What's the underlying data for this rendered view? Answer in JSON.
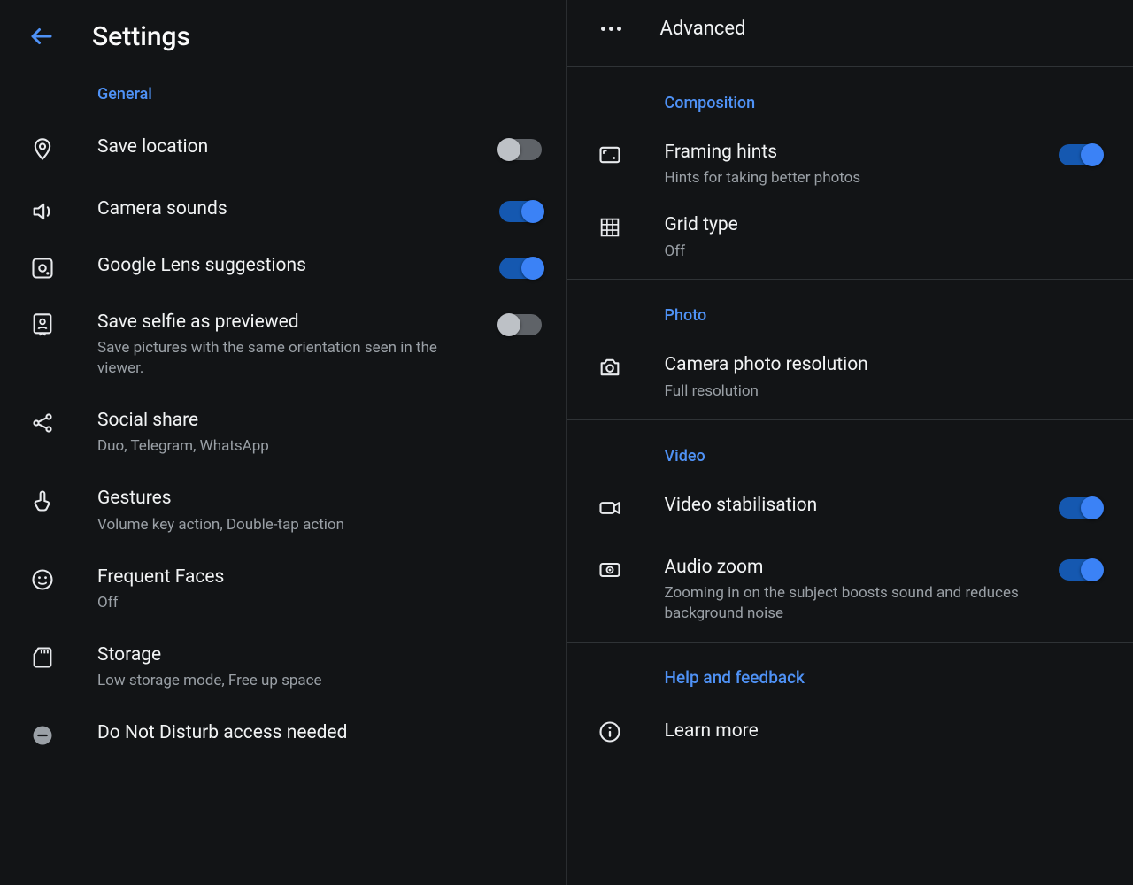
{
  "left": {
    "title": "Settings",
    "section": "General",
    "items": [
      {
        "key": "save-location",
        "title": "Save location",
        "toggle": "off"
      },
      {
        "key": "camera-sounds",
        "title": "Camera sounds",
        "toggle": "on"
      },
      {
        "key": "lens-suggestions",
        "title": "Google Lens suggestions",
        "toggle": "on"
      },
      {
        "key": "save-selfie",
        "title": "Save selfie as previewed",
        "sub": "Save pictures with the same orientation seen in the viewer.",
        "toggle": "off"
      },
      {
        "key": "social-share",
        "title": "Social share",
        "sub": "Duo, Telegram, WhatsApp"
      },
      {
        "key": "gestures",
        "title": "Gestures",
        "sub": "Volume key action, Double-tap action"
      },
      {
        "key": "frequent-faces",
        "title": "Frequent Faces",
        "sub": "Off"
      },
      {
        "key": "storage",
        "title": "Storage",
        "sub": "Low storage mode, Free up space"
      },
      {
        "key": "dnd",
        "title": "Do Not Disturb access needed"
      }
    ]
  },
  "right": {
    "advanced": "Advanced",
    "sections": {
      "composition": {
        "label": "Composition",
        "framing": {
          "title": "Framing hints",
          "sub": "Hints for taking better photos",
          "toggle": "on"
        },
        "grid": {
          "title": "Grid type",
          "sub": "Off"
        }
      },
      "photo": {
        "label": "Photo",
        "resolution": {
          "title": "Camera photo resolution",
          "sub": "Full resolution"
        }
      },
      "video": {
        "label": "Video",
        "stab": {
          "title": "Video stabilisation",
          "toggle": "on"
        },
        "audiozoom": {
          "title": "Audio zoom",
          "sub": "Zooming in on the subject boosts sound and reduces background noise",
          "toggle": "on"
        }
      }
    },
    "help": "Help and feedback",
    "learn": "Learn more"
  }
}
